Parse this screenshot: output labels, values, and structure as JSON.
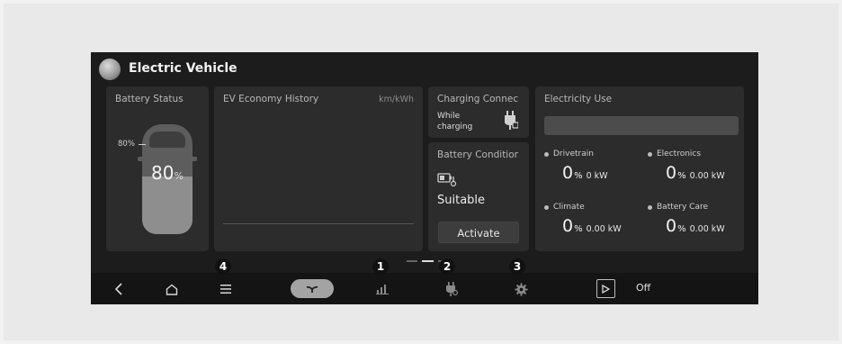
{
  "app": {
    "title": "Electric Vehicle"
  },
  "battery_status": {
    "title": "Battery Status",
    "tick_label": "80%",
    "level_value": "80",
    "level_unit": "%",
    "level_fraction": 0.8
  },
  "economy": {
    "title": "EV Economy History",
    "unit": "km/kWh"
  },
  "charging": {
    "title": "Charging Connec",
    "line1": "While",
    "line2": "charging"
  },
  "battery_condition": {
    "title": "Battery Conditior",
    "value": "Suitable",
    "button_label": "Activate"
  },
  "electricity_use": {
    "title": "Electricity Use",
    "categories": [
      {
        "name": "Drivetrain",
        "value": "0",
        "unit": "%",
        "power": "0 kW"
      },
      {
        "name": "Electronics",
        "value": "0",
        "unit": "%",
        "power": "0.00 kW"
      },
      {
        "name": "Climate",
        "value": "0",
        "unit": "%",
        "power": "0.00 kW"
      },
      {
        "name": "Battery Care",
        "value": "0",
        "unit": "%",
        "power": "0.00 kW"
      }
    ]
  },
  "nav": {
    "icons": [
      "chevron-left-icon",
      "home-icon",
      "menu-icon",
      "leaf-icon",
      "bar-chart-icon",
      "charging-plug-icon",
      "gear-icon",
      "play-icon"
    ],
    "off_label": "Off"
  },
  "callouts": [
    "1",
    "2",
    "3",
    "4"
  ]
}
